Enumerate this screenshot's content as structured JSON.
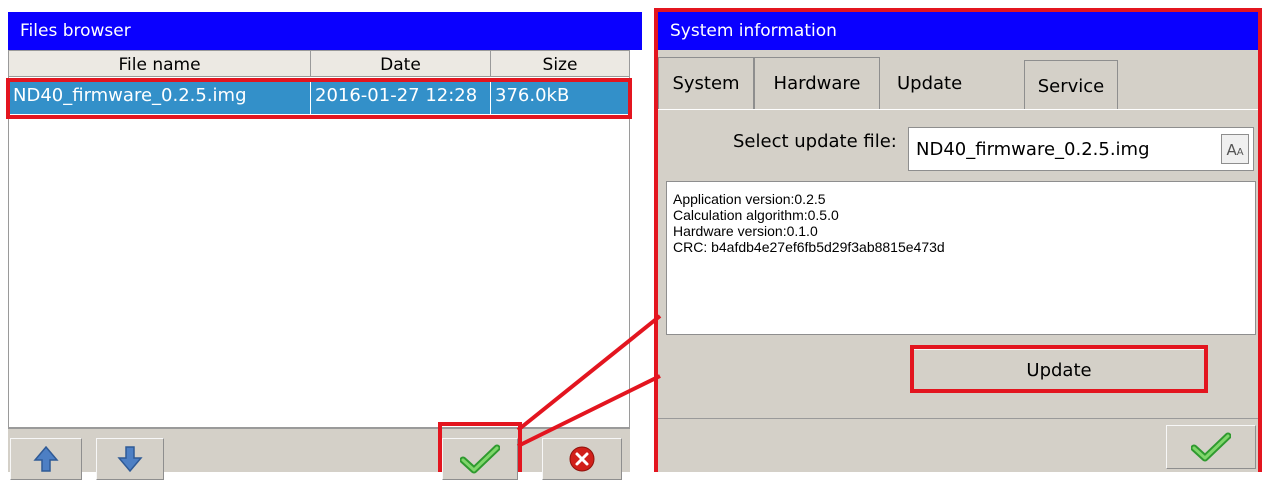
{
  "files_browser": {
    "title": "Files browser",
    "columns": [
      "File name",
      "Date",
      "Size"
    ],
    "rows": [
      {
        "name": "ND40_firmware_0.2.5.img",
        "date": "2016-01-27 12:28",
        "size": "376.0kB",
        "selected": true
      }
    ],
    "toolbar": {
      "up_icon": "arrow-up-icon",
      "down_icon": "arrow-down-icon",
      "confirm_icon": "checkmark-icon",
      "cancel_icon": "close-circle-icon"
    }
  },
  "system_info": {
    "title": "System information",
    "tabs": [
      {
        "label": "System"
      },
      {
        "label": "Hardware"
      },
      {
        "label": "Update",
        "active": true
      },
      {
        "label": "Service"
      }
    ],
    "select_update_file_label": "Select update file:",
    "selected_file": "ND40_firmware_0.2.5.img",
    "keyboard_button_label": "A",
    "keyboard_button_sub": "A",
    "info_lines": [
      "Application version:0.2.5",
      "Calculation algorithm:0.5.0",
      "Hardware version:0.1.0",
      "CRC: b4afdb4e27ef6fb5d29f3ab8815e473d"
    ],
    "update_button_label": "Update",
    "confirm_icon": "checkmark-icon"
  },
  "colors": {
    "titlebar": "#0a00ff",
    "selection": "#3390c9",
    "annotation": "#e3151f",
    "window_bg": "#d4d0c8"
  }
}
